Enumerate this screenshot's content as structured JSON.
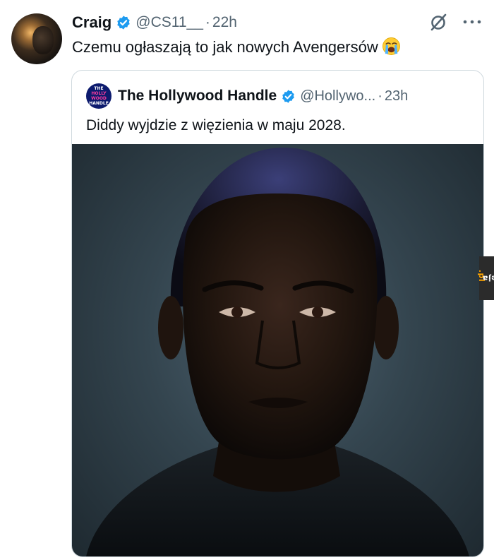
{
  "tweet": {
    "name": "Craig",
    "handle": "@CS11__",
    "separator": "·",
    "time": "22h",
    "text": "Czemu ogłaszają to jak nowych Avengersów",
    "emoji_icon": "loudly-crying-face-icon"
  },
  "quote": {
    "name": "The Hollywood Handle",
    "avatar_lines": [
      "THE",
      "HOLLY",
      "WOOD",
      "HANDLE"
    ],
    "handle": "@Hollywo...",
    "separator": "·",
    "time": "23h",
    "text": "Diddy wyjdzie z więzienia w maju 2028."
  },
  "watermark": {
    "prefix": "jeja",
    "suffix": ".pl"
  },
  "colors": {
    "verified_blue": "#1d9bf0",
    "secondary_text": "#536471",
    "border": "#cfd9de"
  }
}
